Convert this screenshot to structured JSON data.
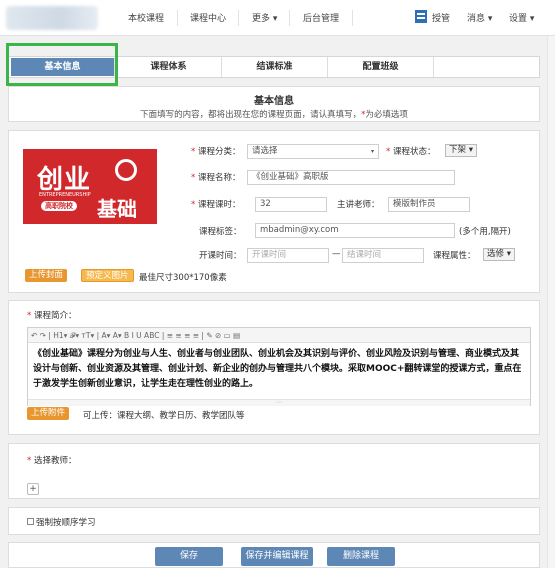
{
  "nav": {
    "items": [
      "本校课程",
      "课程中心",
      "更多 ▾",
      "后台管理"
    ],
    "manage": "授管",
    "messages": "消息 ▾",
    "settings": "设置 ▾"
  },
  "tabs": [
    "基本信息",
    "课程体系",
    "结课标准",
    "配置班级"
  ],
  "header": {
    "title": "基本信息",
    "desc_prefix": "下面填写的内容，都将出现在您的课程页面，请认真填写，",
    "desc_star": "*",
    "desc_suffix": "为必填选项"
  },
  "cover": {
    "line1": "创业",
    "line2": "ENTREPRENEURSHIP",
    "badge": "高职院校",
    "line3": "基础",
    "upload_cover": "上传封面",
    "preset_image": "预定义图片",
    "size_hint": "最佳尺寸300*170像素"
  },
  "form": {
    "category_label": "课程分类：",
    "category_value": "请选择",
    "status_label": "课程状态：",
    "status_value": "下架 ▾",
    "name_label": "课程名称：",
    "name_value": "《创业基础》高职版",
    "hours_label": "课程课时：",
    "hours_value": "32",
    "teacher_label": "主讲老师：",
    "teacher_value": "模版制作员",
    "tags_label": "课程标签：",
    "tags_value": "mbadmin@xy.com",
    "tags_hint": "(多个用,隔开)",
    "open_label": "开课时间：",
    "start_placeholder": "开课时间",
    "dash": "—",
    "end_placeholder": "结课时间",
    "attr_label": "课程属性：",
    "attr_value": "选修 ▾"
  },
  "intro": {
    "label": "课程简介：",
    "toolbar": "↶ ↷ | H1▾ 𝓕▾ ᴛT▾ | A▾ A▾ B I U ABC | ≡ ≡ ≡ ≡ | ✎ ⊘ ▭ ▤",
    "text": "《创业基础》课程分为创业与人生、创业者与创业团队、创业机会及其识别与评价、创业风险及识别与管理、商业模式及其设计与创新、创业资源及其管理、创业计划、新企业的创办与管理共八个模块。采取MOOC+翻转课堂的授课方式，重点在于激发学生创新创业意识，让学生走在理性创业的路上。",
    "upload_attachment": "上传附件",
    "attach_hint": "可上传：课程大纲、教学日历、教学团队等"
  },
  "teacher": {
    "label": "选择教师：",
    "add": "+"
  },
  "sequence": {
    "label": "强制按顺序学习"
  },
  "buttons": {
    "save": "保存",
    "save_edit": "保存并编辑课程",
    "delete": "删除课程"
  },
  "colors": {
    "accent": "#5d87b5",
    "orange": "#e8962e",
    "required": "#d8262d",
    "highlight": "#3ab54a"
  }
}
